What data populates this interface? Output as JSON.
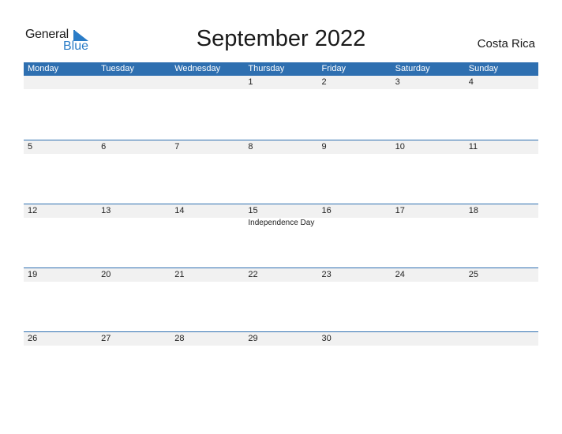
{
  "logo": {
    "line1": "General",
    "line2": "Blue"
  },
  "title": "September 2022",
  "country": "Costa Rica",
  "colors": {
    "header": "#2e6fb0",
    "accent": "#2a7cc7",
    "strip": "#f1f1f1"
  },
  "weekdays": [
    "Monday",
    "Tuesday",
    "Wednesday",
    "Thursday",
    "Friday",
    "Saturday",
    "Sunday"
  ],
  "weeks": [
    {
      "days": [
        "",
        "",
        "",
        "1",
        "2",
        "3",
        "4"
      ],
      "events": [
        "",
        "",
        "",
        "",
        "",
        "",
        ""
      ]
    },
    {
      "days": [
        "5",
        "6",
        "7",
        "8",
        "9",
        "10",
        "11"
      ],
      "events": [
        "",
        "",
        "",
        "",
        "",
        "",
        ""
      ]
    },
    {
      "days": [
        "12",
        "13",
        "14",
        "15",
        "16",
        "17",
        "18"
      ],
      "events": [
        "",
        "",
        "",
        "Independence Day",
        "",
        "",
        ""
      ]
    },
    {
      "days": [
        "19",
        "20",
        "21",
        "22",
        "23",
        "24",
        "25"
      ],
      "events": [
        "",
        "",
        "",
        "",
        "",
        "",
        ""
      ]
    },
    {
      "days": [
        "26",
        "27",
        "28",
        "29",
        "30",
        "",
        ""
      ],
      "events": [
        "",
        "",
        "",
        "",
        "",
        "",
        ""
      ]
    }
  ]
}
